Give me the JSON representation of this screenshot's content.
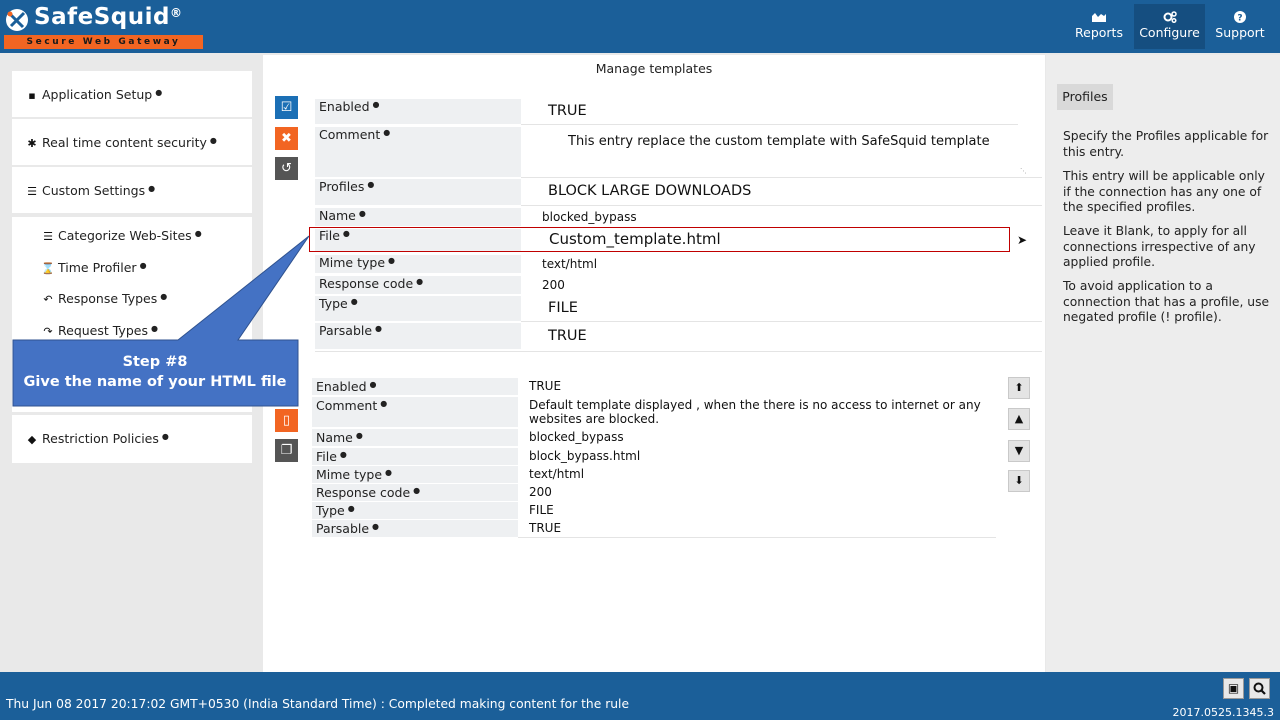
{
  "header": {
    "logo_text": "SafeSquid",
    "logo_reg": "®",
    "logo_tagline": "Secure Web Gateway",
    "nav": [
      {
        "label": "Reports",
        "icon": "chart-icon"
      },
      {
        "label": "Configure",
        "icon": "gears-icon"
      },
      {
        "label": "Support",
        "icon": "question-icon"
      }
    ]
  },
  "left_menu": {
    "application_setup": "Application Setup",
    "real_time": "Real time content security",
    "custom_settings": "Custom Settings",
    "categorize": "Categorize Web-Sites",
    "time_profiler": "Time Profiler",
    "response_types": "Response Types",
    "request_types": "Request Types",
    "restriction": "Restriction Policies"
  },
  "main": {
    "title": "Manage templates",
    "edit_entry": {
      "enabled_label": "Enabled",
      "enabled_value": "TRUE",
      "comment_label": "Comment",
      "comment_value": "This entry replace the custom template with SafeSquid template",
      "profiles_label": "Profiles",
      "profiles_value": "BLOCK LARGE DOWNLOADS",
      "name_label": "Name",
      "name_value": "blocked_bypass",
      "file_label": "File",
      "file_value": "Custom_template.html",
      "mime_label": "Mime type",
      "mime_value": "text/html",
      "response_label": "Response code",
      "response_value": "200",
      "type_label": "Type",
      "type_value": "FILE",
      "parsable_label": "Parsable",
      "parsable_value": "TRUE"
    },
    "entry2": {
      "enabled_label": "Enabled",
      "enabled_value": "TRUE",
      "comment_label": "Comment",
      "comment_value": "Default template displayed , when the there is no access to internet or any websites are blocked.",
      "name_label": "Name",
      "name_value": "blocked_bypass",
      "file_label": "File",
      "file_value": "block_bypass.html",
      "mime_label": "Mime type",
      "mime_value": "text/html",
      "response_label": "Response code",
      "response_value": "200",
      "type_label": "Type",
      "type_value": "FILE",
      "parsable_label": "Parsable",
      "parsable_value": "TRUE"
    }
  },
  "right_panel": {
    "tab": "Profiles",
    "p1": "Specify the Profiles applicable for this entry.",
    "p2": "This entry will be applicable only if the connection has any one of the specified profiles.",
    "p3": "Leave it Blank, to apply for all connections irrespective of any applied profile.",
    "p4": "To avoid application to a connection that has a profile, use negated profile (! profile)."
  },
  "callout": {
    "line1": "Step #8",
    "line2": "Give the name of your HTML file"
  },
  "footer": {
    "status": "Thu Jun 08 2017 20:17:02 GMT+0530 (India Standard Time) : Completed making content for the rule",
    "version": "2017.0525.1345.3"
  },
  "colors": {
    "header_bg": "#1b5f99",
    "accent_orange": "#f26522",
    "callout_bg": "#4472c4",
    "highlight_red": "#c00000"
  }
}
